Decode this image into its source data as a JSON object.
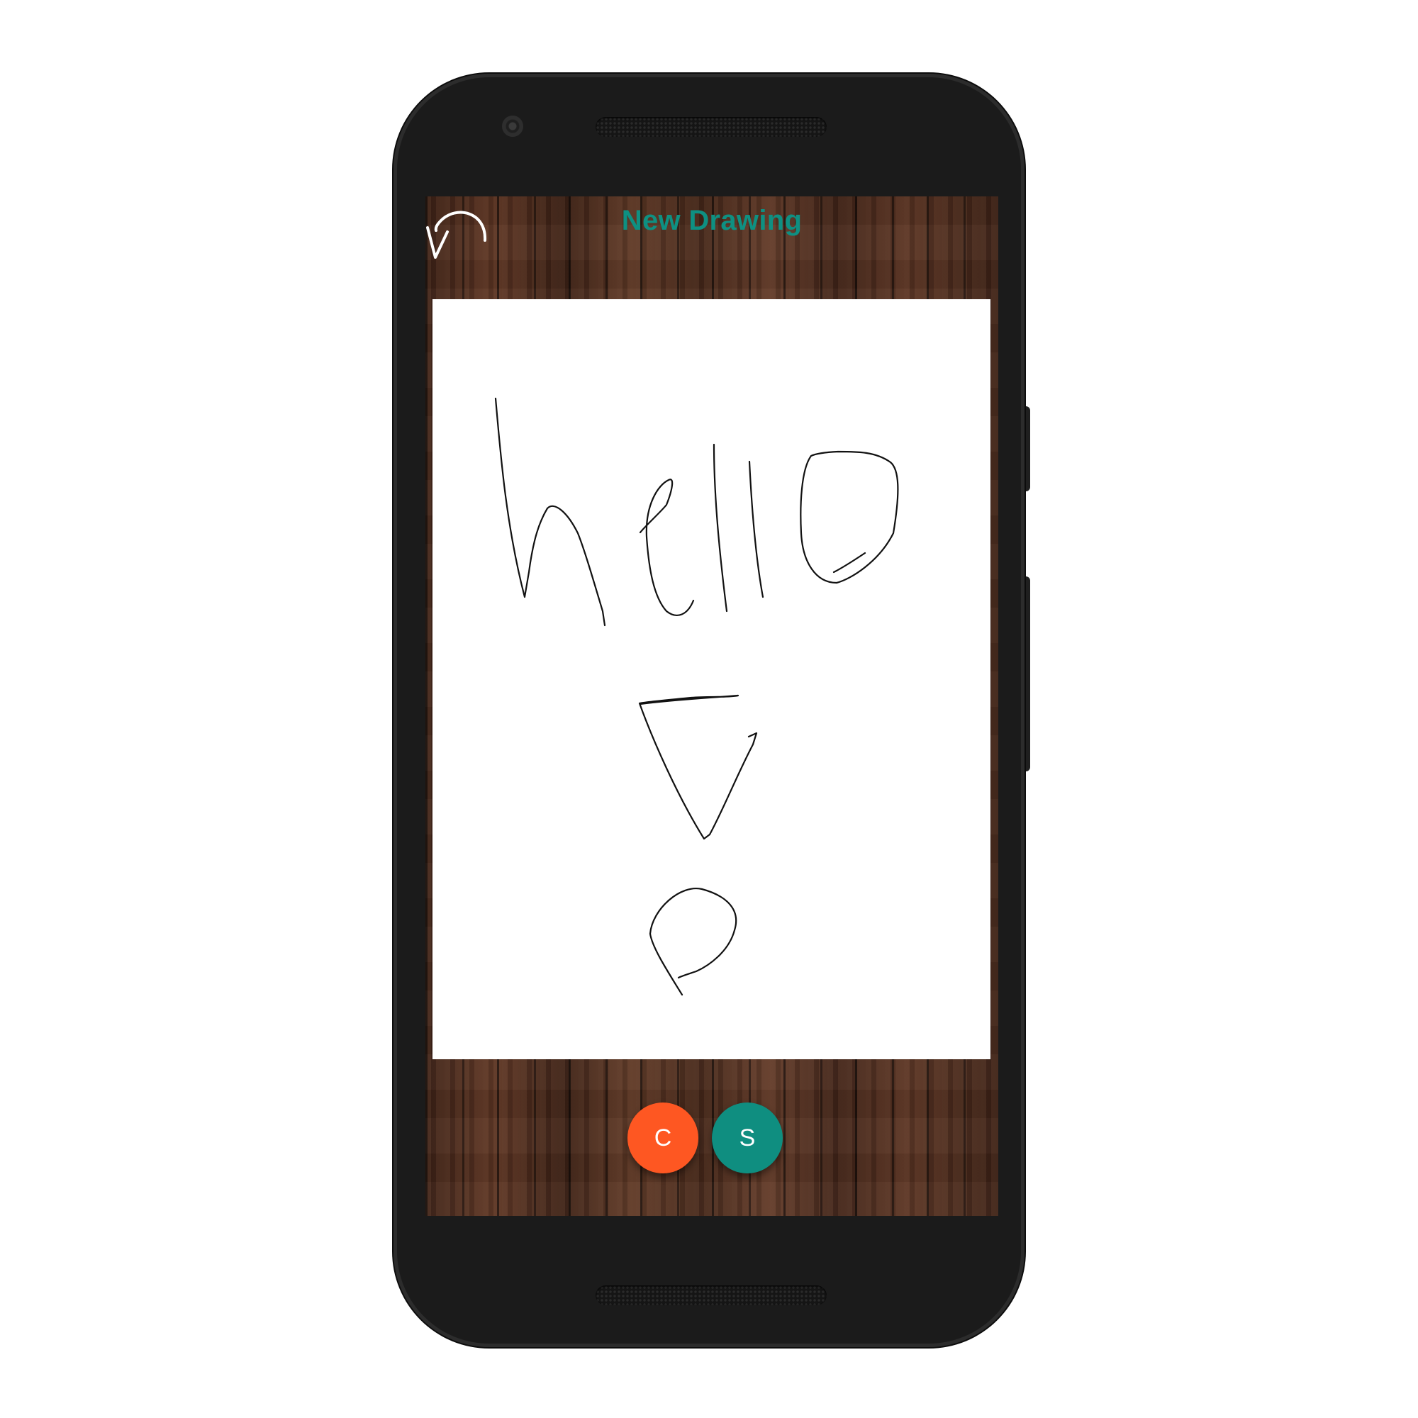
{
  "app": {
    "title": "New Drawing"
  },
  "toolbar": {
    "undo_icon": "undo-icon"
  },
  "canvas": {
    "stroke_color": "#111111",
    "background": "#ffffff"
  },
  "actions": {
    "clear_label": "C",
    "save_label": "S",
    "clear_color": "#fe5722",
    "save_color": "#0f8e80"
  },
  "colors": {
    "title": "#0e9082",
    "device_body": "#1b1b1b"
  }
}
